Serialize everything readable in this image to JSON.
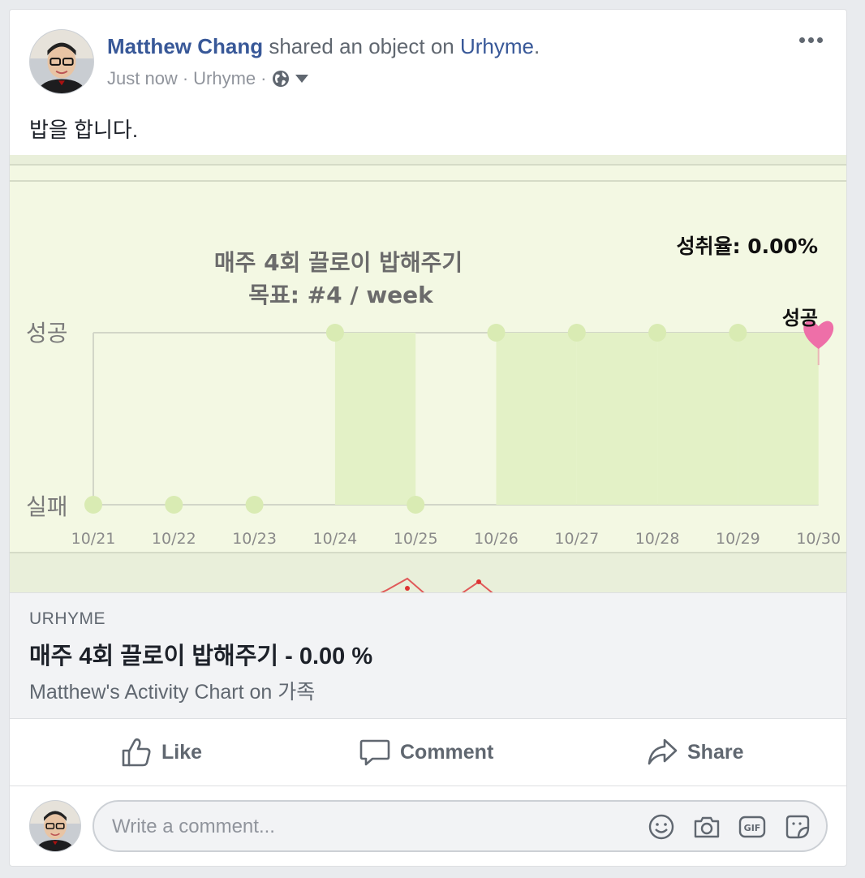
{
  "post": {
    "author": "Matthew Chang",
    "action_text": "shared an object on",
    "app_name": "Urhyme",
    "period": ".",
    "time": "Just now",
    "separator": "·",
    "source": "Urhyme",
    "audience_icon": "globe-icon",
    "text": "밥을 합니다."
  },
  "chart_data": {
    "type": "area",
    "title": "매주 4회 끌로이 밥해주기",
    "subtitle": "목표: #4 /  week",
    "achievement_label": "성취율: 0.00%",
    "y_categories": [
      "실패",
      "성공"
    ],
    "categories": [
      "10/21",
      "10/22",
      "10/23",
      "10/24",
      "10/25",
      "10/26",
      "10/27",
      "10/28",
      "10/29",
      "10/30"
    ],
    "values": [
      0,
      0,
      0,
      1,
      0,
      1,
      1,
      1,
      1,
      1
    ],
    "end_label": "성공",
    "end_marker_icon": "heart-icon",
    "colors": {
      "background": "#f3f8e3",
      "fill": "#e3f1c6",
      "dot": "#d9ebb3",
      "line": "#d2d6c8",
      "heart": "#ee6fa8"
    }
  },
  "link": {
    "domain": "URHYME",
    "title": "매주 4회 끌로이 밥해주기 - 0.00 %",
    "subtitle": "Matthew's Activity Chart on 가족"
  },
  "actions": {
    "like": "Like",
    "comment": "Comment",
    "share": "Share"
  },
  "comment": {
    "placeholder": "Write a comment...",
    "icons": [
      "emoji-icon",
      "camera-icon",
      "gif-icon",
      "sticker-icon"
    ]
  }
}
